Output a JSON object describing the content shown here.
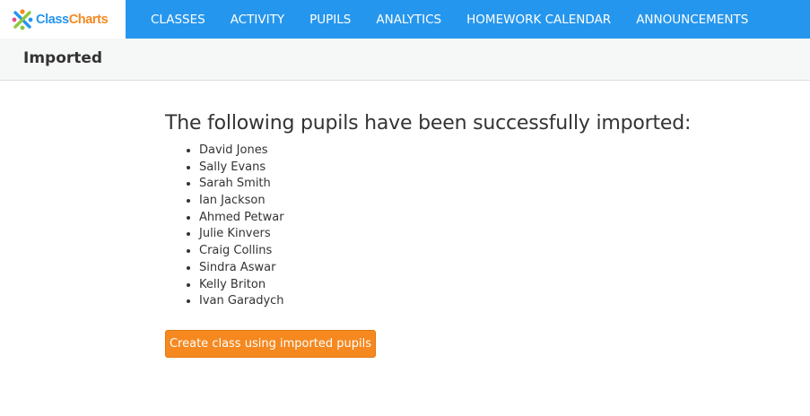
{
  "brand": {
    "name_class": "Class",
    "name_charts": "Charts",
    "icon": "classcharts-logo-icon",
    "colors": {
      "primary": "#2596ee",
      "accent": "#f5881f"
    }
  },
  "nav": {
    "items": [
      {
        "label": "CLASSES"
      },
      {
        "label": "ACTIVITY"
      },
      {
        "label": "PUPILS"
      },
      {
        "label": "ANALYTICS"
      },
      {
        "label": "HOMEWORK CALENDAR"
      },
      {
        "label": "ANNOUNCEMENTS"
      }
    ]
  },
  "page": {
    "title": "Imported"
  },
  "main": {
    "heading": "The following pupils have been successfully imported:",
    "pupils": [
      "David Jones",
      "Sally Evans",
      "Sarah Smith",
      "Ian Jackson",
      "Ahmed Petwar",
      "Julie Kinvers",
      "Craig Collins",
      "Sindra Aswar",
      "Kelly Briton",
      "Ivan Garadych"
    ],
    "create_button_label": "Create class using imported pupils"
  }
}
